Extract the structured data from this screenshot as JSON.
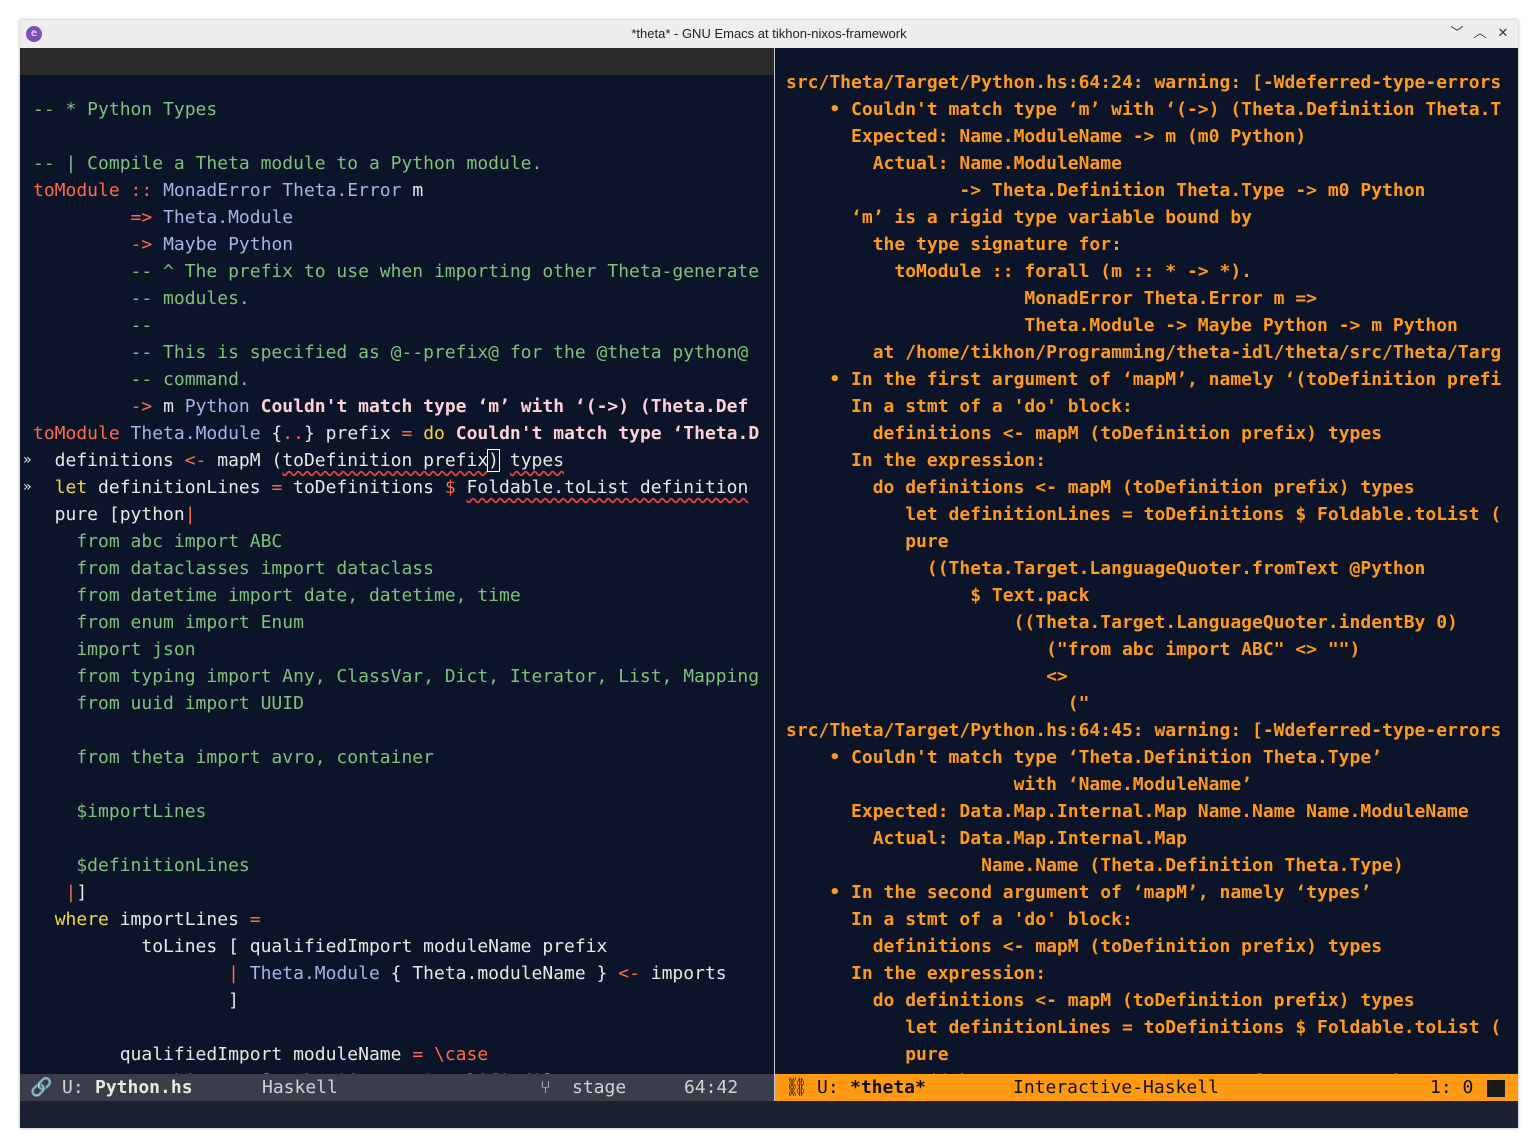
{
  "window": {
    "title": "*theta* - GNU Emacs at tikhon-nixos-framework",
    "controls": [
      "﹀",
      "︿",
      "✕"
    ]
  },
  "left": {
    "lines": [
      {
        "parts": [
          {
            "t": "-- * Python Types",
            "c": "cmt"
          }
        ]
      },
      {
        "parts": []
      },
      {
        "parts": [
          {
            "t": "-- | Compile a Theta module to a Python module.",
            "c": "cmt"
          }
        ]
      },
      {
        "parts": [
          {
            "t": "toModule",
            "c": "ker"
          },
          {
            "t": " :: ",
            "c": "ker"
          },
          {
            "t": "MonadError Theta.Error",
            "c": "typ"
          },
          {
            "t": " m"
          }
        ]
      },
      {
        "parts": [
          {
            "t": "         "
          },
          {
            "t": "=>",
            "c": "ker"
          },
          {
            "t": " Theta.Module",
            "c": "typ"
          }
        ]
      },
      {
        "parts": [
          {
            "t": "         "
          },
          {
            "t": "->",
            "c": "ker"
          },
          {
            "t": " Maybe Python",
            "c": "typ"
          }
        ]
      },
      {
        "parts": [
          {
            "t": "         -- ^ The prefix to use when importing other Theta-generate",
            "c": "cmt"
          }
        ],
        "more": true
      },
      {
        "parts": [
          {
            "t": "         -- modules.",
            "c": "cmt"
          }
        ]
      },
      {
        "parts": [
          {
            "t": "         --",
            "c": "cmt"
          }
        ]
      },
      {
        "parts": [
          {
            "t": "         -- This is specified as @--prefix@ for the @theta python@",
            "c": "cmt"
          }
        ]
      },
      {
        "parts": [
          {
            "t": "         -- command.",
            "c": "cmt"
          }
        ]
      },
      {
        "parts": [
          {
            "t": "         "
          },
          {
            "t": "->",
            "c": "ker"
          },
          {
            "t": " m "
          },
          {
            "t": "Python",
            "c": "typ"
          },
          {
            "t": " Couldn't match type ‘m’ with ‘(->) (Theta.Def",
            "c": "err"
          }
        ],
        "more": true
      },
      {
        "parts": [
          {
            "t": "toModule",
            "c": "ker"
          },
          {
            "t": " "
          },
          {
            "t": "Theta.Module",
            "c": "typ"
          },
          {
            "t": " {"
          },
          {
            "t": "..",
            "c": "ker"
          },
          {
            "t": "} prefix "
          },
          {
            "t": "=",
            "c": "ker"
          },
          {
            "t": " "
          },
          {
            "t": "do",
            "c": "kw"
          },
          {
            "t": " Couldn't match type ‘Theta.D",
            "c": "err"
          }
        ],
        "more": true
      },
      {
        "fringe": "»",
        "parts": [
          {
            "t": "  definitions "
          },
          {
            "t": "<-",
            "c": "ker"
          },
          {
            "t": " mapM ("
          },
          {
            "t": "toDefinition prefix",
            "c": "squig"
          },
          {
            "t": ")",
            "c": "cursor"
          },
          {
            "t": " "
          },
          {
            "t": "types",
            "c": "squig"
          }
        ]
      },
      {
        "fringe": "»",
        "parts": [
          {
            "t": "  "
          },
          {
            "t": "let",
            "c": "kw"
          },
          {
            "t": " definitionLines "
          },
          {
            "t": "=",
            "c": "ker"
          },
          {
            "t": " toDefinitions "
          },
          {
            "t": "$",
            "c": "ker"
          },
          {
            "t": " "
          },
          {
            "t": "Foldable.toList definition",
            "c": "squig"
          }
        ],
        "more": true
      },
      {
        "parts": [
          {
            "t": "  pure [python"
          },
          {
            "t": "|",
            "c": "ker"
          }
        ]
      },
      {
        "parts": [
          {
            "t": "    from abc import ABC",
            "c": "str"
          }
        ]
      },
      {
        "parts": [
          {
            "t": "    from dataclasses import dataclass",
            "c": "str"
          }
        ]
      },
      {
        "parts": [
          {
            "t": "    from datetime import date, datetime, time",
            "c": "str"
          }
        ]
      },
      {
        "parts": [
          {
            "t": "    from enum import Enum",
            "c": "str"
          }
        ]
      },
      {
        "parts": [
          {
            "t": "    import json",
            "c": "str"
          }
        ]
      },
      {
        "parts": [
          {
            "t": "    from typing import Any, ClassVar, Dict, Iterator, List, Mapping",
            "c": "str"
          }
        ],
        "more": true
      },
      {
        "parts": [
          {
            "t": "    from uuid import UUID",
            "c": "str"
          }
        ]
      },
      {
        "parts": []
      },
      {
        "parts": [
          {
            "t": "    from theta import avro, container",
            "c": "str"
          }
        ]
      },
      {
        "parts": []
      },
      {
        "parts": [
          {
            "t": "    $importLines",
            "c": "str"
          }
        ]
      },
      {
        "parts": []
      },
      {
        "parts": [
          {
            "t": "    $definitionLines",
            "c": "str"
          }
        ]
      },
      {
        "parts": [
          {
            "t": "   "
          },
          {
            "t": "|",
            "c": "ker"
          },
          {
            "t": "]"
          }
        ]
      },
      {
        "parts": [
          {
            "t": "  "
          },
          {
            "t": "where",
            "c": "kw"
          },
          {
            "t": " importLines "
          },
          {
            "t": "=",
            "c": "ker"
          }
        ]
      },
      {
        "parts": [
          {
            "t": "          toLines [ qualifiedImport moduleName prefix"
          }
        ]
      },
      {
        "parts": [
          {
            "t": "                  "
          },
          {
            "t": "|",
            "c": "ker"
          },
          {
            "t": " "
          },
          {
            "t": "Theta.Module",
            "c": "typ"
          },
          {
            "t": " { Theta.moduleName } "
          },
          {
            "t": "<-",
            "c": "ker"
          },
          {
            "t": " imports"
          }
        ]
      },
      {
        "parts": [
          {
            "t": "                  ]"
          }
        ]
      },
      {
        "parts": []
      },
      {
        "parts": [
          {
            "t": "        qualifiedImport moduleName "
          },
          {
            "t": "=",
            "c": "ker"
          },
          {
            "t": " "
          },
          {
            "t": "\\case",
            "c": "ker"
          }
        ]
      },
      {
        "parts": [
          {
            "t": "          "
          },
          {
            "t": "Nothing",
            "c": "typ"
          },
          {
            "t": " "
          },
          {
            "t": "->",
            "c": "ker"
          },
          {
            "t": " [python"
          },
          {
            "t": "|",
            "c": "ker"
          },
          {
            "t": "import $qualified",
            "c": "str"
          },
          {
            "t": "|",
            "c": "ker"
          },
          {
            "t": "]"
          }
        ]
      }
    ]
  },
  "right": {
    "lines": [
      {
        "text": "src/Theta/Target/Python.hs:64:24: warning: [-Wdeferred-type-errors",
        "more": true
      },
      {
        "text": "    • Couldn't match type ‘m’ with ‘(->) (Theta.Definition Theta.T",
        "more": true
      },
      {
        "text": "      Expected: Name.ModuleName -> m (m0 Python)"
      },
      {
        "text": "        Actual: Name.ModuleName"
      },
      {
        "text": "                -> Theta.Definition Theta.Type -> m0 Python"
      },
      {
        "text": "      ‘m’ is a rigid type variable bound by"
      },
      {
        "text": "        the type signature for:"
      },
      {
        "text": "          toModule :: forall (m :: * -> *)."
      },
      {
        "text": "                      MonadError Theta.Error m =>"
      },
      {
        "text": "                      Theta.Module -> Maybe Python -> m Python"
      },
      {
        "text": "        at /home/tikhon/Programming/theta-idl/theta/src/Theta/Targ",
        "more": true
      },
      {
        "text": "    • In the first argument of ‘mapM’, namely ‘(toDefinition prefi",
        "more": true
      },
      {
        "text": "      In a stmt of a 'do' block:"
      },
      {
        "text": "        definitions <- mapM (toDefinition prefix) types"
      },
      {
        "text": "      In the expression:"
      },
      {
        "text": "        do definitions <- mapM (toDefinition prefix) types"
      },
      {
        "text": "           let definitionLines = toDefinitions $ Foldable.toList (",
        "more": true
      },
      {
        "text": "           pure"
      },
      {
        "text": "             ((Theta.Target.LanguageQuoter.fromText @Python"
      },
      {
        "text": "                 $ Text.pack"
      },
      {
        "text": "                     ((Theta.Target.LanguageQuoter.indentBy 0)"
      },
      {
        "text": "                        (\"from abc import ABC\" <> \"\")"
      },
      {
        "text": "                        <>"
      },
      {
        "text": "                          (\""
      },
      {
        "text": "src/Theta/Target/Python.hs:64:45: warning: [-Wdeferred-type-errors",
        "more": true
      },
      {
        "text": "    • Couldn't match type ‘Theta.Definition Theta.Type’"
      },
      {
        "text": "                     with ‘Name.ModuleName’"
      },
      {
        "text": "      Expected: Data.Map.Internal.Map Name.Name Name.ModuleName"
      },
      {
        "text": "        Actual: Data.Map.Internal.Map"
      },
      {
        "text": "                  Name.Name (Theta.Definition Theta.Type)"
      },
      {
        "text": "    • In the second argument of ‘mapM’, namely ‘types’"
      },
      {
        "text": "      In a stmt of a 'do' block:"
      },
      {
        "text": "        definitions <- mapM (toDefinition prefix) types"
      },
      {
        "text": "      In the expression:"
      },
      {
        "text": "        do definitions <- mapM (toDefinition prefix) types"
      },
      {
        "text": "           let definitionLines = toDefinitions $ Foldable.toList (",
        "more": true
      },
      {
        "text": "           pure"
      },
      {
        "text": "             ((Theta.Target.LanguageQuoter.fromText @Python"
      }
    ]
  },
  "modeline_left": {
    "icon": "🔗",
    "state": "U:",
    "buffer": "Python.hs",
    "mode": "Haskell",
    "vc_icon": "⑂",
    "branch": "stage",
    "position": "64:42"
  },
  "modeline_right": {
    "icon": "⛓",
    "state": "U:",
    "buffer": "*theta*",
    "mode": "Interactive-Haskell",
    "position": "1: 0"
  },
  "colors": {
    "background": "#0b1428",
    "comment": "#7ec27e",
    "keyword_red": "#ff6b4a",
    "type": "#a7b4e6",
    "keyword_yellow": "#f2d74a",
    "warning": "#ff9a1f",
    "modeline_active": "#ff9a12",
    "modeline_inactive": "#3b3e48"
  }
}
